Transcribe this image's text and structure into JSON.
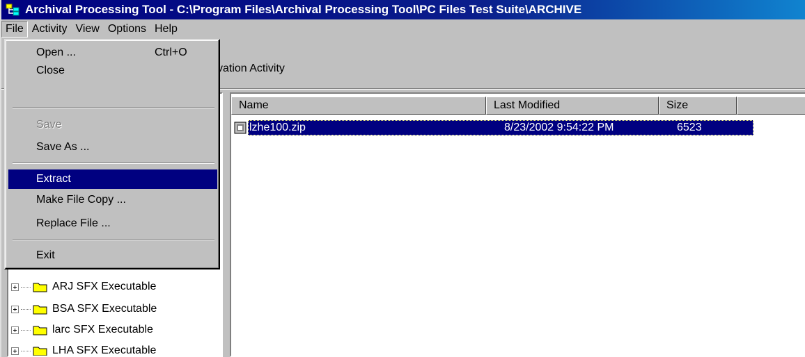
{
  "window": {
    "title": "Archival Processing Tool - C:\\Program Files\\Archival Processing Tool\\PC Files Test Suite\\ARCHIVE"
  },
  "menubar": [
    "File",
    "Activity",
    "View",
    "Options",
    "Help"
  ],
  "toolbar": {
    "label": "vation Activity"
  },
  "file_menu": {
    "items": [
      {
        "label": "Open ...",
        "shortcut": "Ctrl+O",
        "state": "normal"
      },
      {
        "label": "Close",
        "state": "normal"
      },
      {
        "label": "Save",
        "state": "disabled"
      },
      {
        "label": "Save As ...",
        "state": "normal"
      },
      {
        "label": "Extract",
        "state": "highlighted"
      },
      {
        "label": "Make File Copy ...",
        "state": "normal"
      },
      {
        "label": "Replace File ...",
        "state": "normal"
      },
      {
        "label": "Exit",
        "state": "normal"
      }
    ]
  },
  "tree": {
    "items": [
      {
        "label": "ARJ SFX Executable"
      },
      {
        "label": "BSA SFX Executable"
      },
      {
        "label": "larc SFX Executable"
      },
      {
        "label": "LHA SFX Executable"
      }
    ]
  },
  "list": {
    "columns": [
      "Name",
      "Last Modified",
      "Size"
    ],
    "rows": [
      {
        "name": "lzhe100.zip",
        "last_modified": "8/23/2002 9:54:22 PM",
        "size": "6523",
        "selected": true
      }
    ]
  },
  "colors": {
    "title_bar": "#000080",
    "selection": "#000080",
    "face": "#c0c0c0"
  },
  "icons": [
    "app-icon",
    "folder-icon",
    "file-icon",
    "tree-expander-icon"
  ]
}
